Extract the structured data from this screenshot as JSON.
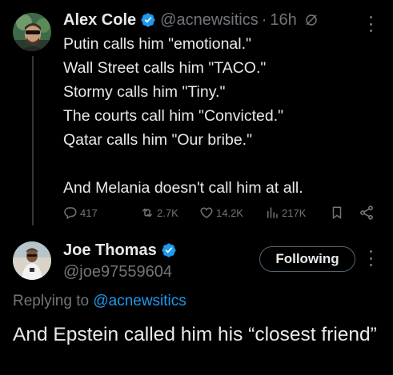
{
  "tweet": {
    "author": {
      "name": "Alex Cole",
      "handle": "@acnewsitics",
      "time": "16h",
      "verified": true
    },
    "lines": [
      "Putin calls him \"emotional.\"",
      "Wall Street calls him \"TACO.\"",
      "Stormy calls him \"Tiny.\"",
      "The courts call him \"Convicted.\"",
      "Qatar calls him \"Our bribe.\"",
      "And Melania doesn't call him at all."
    ],
    "stats": {
      "replies": "417",
      "reposts": "2.7K",
      "likes": "14.2K",
      "views": "217K"
    }
  },
  "reply": {
    "author": {
      "name": "Joe Thomas",
      "handle": "@joe97559604",
      "verified": true
    },
    "follow_label": "Following",
    "replying_prefix": "Replying to",
    "replying_handle": "@acnewsitics",
    "text": "And Epstein called him his “closest friend”"
  },
  "colors": {
    "background": "#000000",
    "text_primary": "#e7e9ea",
    "text_secondary": "#71767b",
    "accent": "#1d9bf0",
    "divider": "#333639"
  },
  "icons": [
    "verified-badge-icon",
    "grok-icon",
    "more-icon",
    "reply-icon",
    "repost-icon",
    "like-icon",
    "views-icon",
    "bookmark-icon",
    "share-icon"
  ]
}
